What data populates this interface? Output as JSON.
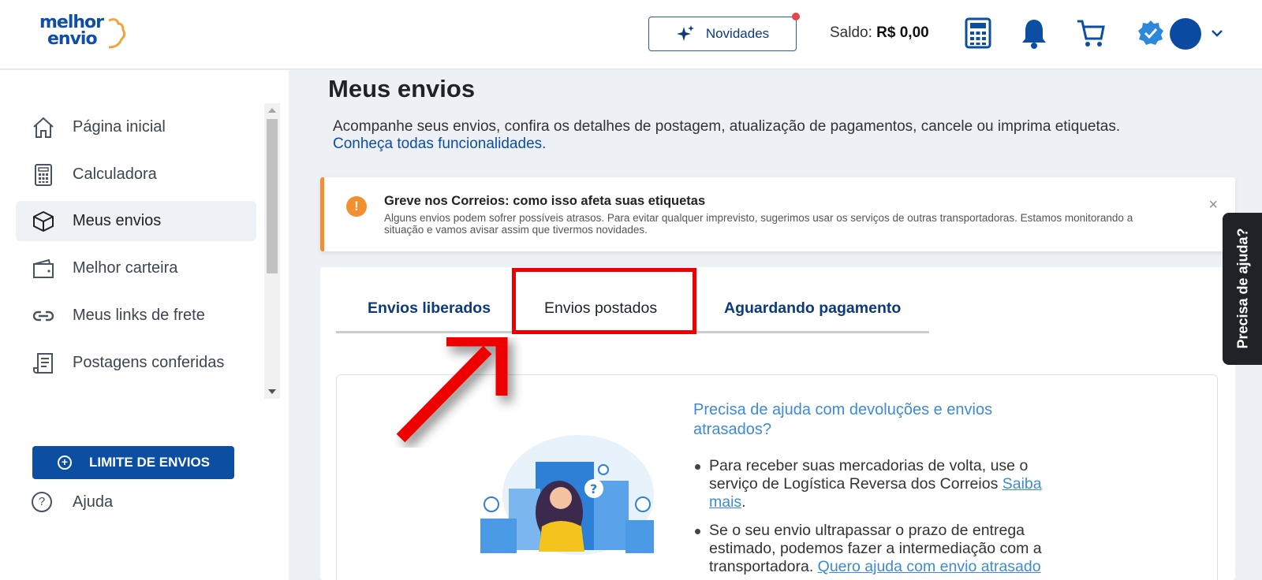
{
  "header": {
    "logo_line1": "melhor",
    "logo_line2": "envio",
    "news_label": "Novidades",
    "saldo_label": "Saldo:",
    "saldo_value": "R$ 0,00"
  },
  "sidebar": {
    "items": [
      {
        "label": "Página inicial",
        "icon": "home-icon"
      },
      {
        "label": "Calculadora",
        "icon": "calculator-icon"
      },
      {
        "label": "Meus envios",
        "icon": "box-icon"
      },
      {
        "label": "Melhor carteira",
        "icon": "wallet-icon"
      },
      {
        "label": "Meus links de frete",
        "icon": "link-icon"
      },
      {
        "label": "Postagens conferidas",
        "icon": "receipt-icon"
      }
    ],
    "active_index": 2,
    "limit_button": "LIMITE DE ENVIOS",
    "help_label": "Ajuda"
  },
  "main": {
    "title": "Meus envios",
    "description": "Acompanhe seus envios, confira os detalhes de postagem, atualização de pagamentos, cancele ou imprima etiquetas.",
    "link": "Conheça todas funcionalidades."
  },
  "alert": {
    "title": "Greve nos Correios: como isso afeta suas etiquetas",
    "body": "Alguns envios podem sofrer possíveis atrasos. Para evitar qualquer imprevisto, sugerimos usar os serviços de outras transportadoras. Estamos monitorando a situação e vamos avisar assim que tivermos novidades.",
    "close": "×"
  },
  "tabs": [
    {
      "label": "Envios liberados"
    },
    {
      "label": "Envios postados"
    },
    {
      "label": "Aguardando pagamento"
    }
  ],
  "help_panel": {
    "title": "Precisa de ajuda com devoluções e envios atrasados?",
    "bullet1_text": "Para receber suas mercadorias de volta, use o serviço de Logística Reversa dos Correios ",
    "bullet1_link": "Saiba mais",
    "bullet1_end": ".",
    "bullet2_text": "Se o seu envio ultrapassar o prazo de entrega estimado, podemos fazer a intermediação com a transportadora. ",
    "bullet2_link": "Quero ajuda com envio atrasado"
  },
  "side_tab": "Precisa de ajuda?",
  "colors": {
    "brand": "#0b4ea2",
    "alert_accent": "#f28f2e",
    "highlight": "#ee0000"
  }
}
